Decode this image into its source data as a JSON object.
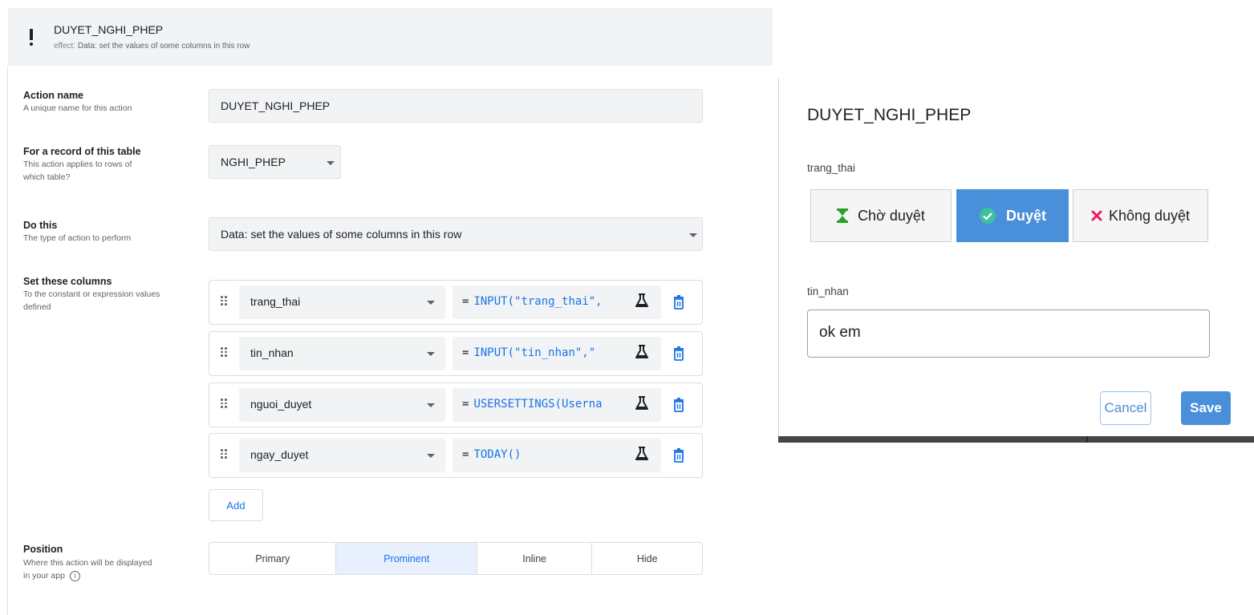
{
  "editor": {
    "action_title": "DUYET_NGHI_PHEP",
    "effect_key": "effect:",
    "effect_value": "Data: set the values of some columns in this row",
    "action_name": {
      "label": "Action name",
      "description": "A unique name for this action",
      "value": "DUYET_NGHI_PHEP"
    },
    "table": {
      "label": "For a record of this table",
      "description": "This action applies to rows of which table?",
      "value": "NGHI_PHEP"
    },
    "do_this": {
      "label": "Do this",
      "description": "The type of action to perform",
      "value": "Data: set the values of some columns in this row"
    },
    "set_columns": {
      "label": "Set these columns",
      "description": "To the constant or expression values defined",
      "rows": [
        {
          "column": "trang_thai",
          "eq": "=",
          "expression": "INPUT(\"trang_thai\","
        },
        {
          "column": "tin_nhan",
          "eq": "=",
          "expression": "INPUT(\"tin_nhan\",\""
        },
        {
          "column": "nguoi_duyet",
          "eq": "=",
          "expression": "USERSETTINGS(Userna"
        },
        {
          "column": "ngay_duyet",
          "eq": "=",
          "expression": "TODAY()"
        }
      ],
      "add_label": "Add"
    },
    "position": {
      "label": "Position",
      "description_line1": "Where this action will be displayed",
      "description_line2": "in your app",
      "info_glyph": "i",
      "options": [
        "Primary",
        "Prominent",
        "Inline",
        "Hide"
      ],
      "selected": "Prominent"
    }
  },
  "dialog": {
    "title": "DUYET_NGHI_PHEP",
    "field1_label": "trang_thai",
    "options": [
      {
        "label": "Chờ duyệt",
        "icon": "hourglass-icon",
        "color": "#2ca02c"
      },
      {
        "label": "Duyệt",
        "icon": "check-circle-icon",
        "color": "#ffffff"
      },
      {
        "label": "Không duyệt",
        "icon": "close-x-icon",
        "color": "#e91e63"
      }
    ],
    "selected_option": "Duyệt",
    "field2_label": "tin_nhan",
    "field2_value": "ok em",
    "cancel_label": "Cancel",
    "save_label": "Save"
  },
  "colors": {
    "accent": "#1a73e8",
    "dialog_accent": "#4a8fd9",
    "header_bg": "#f1f3f4"
  }
}
